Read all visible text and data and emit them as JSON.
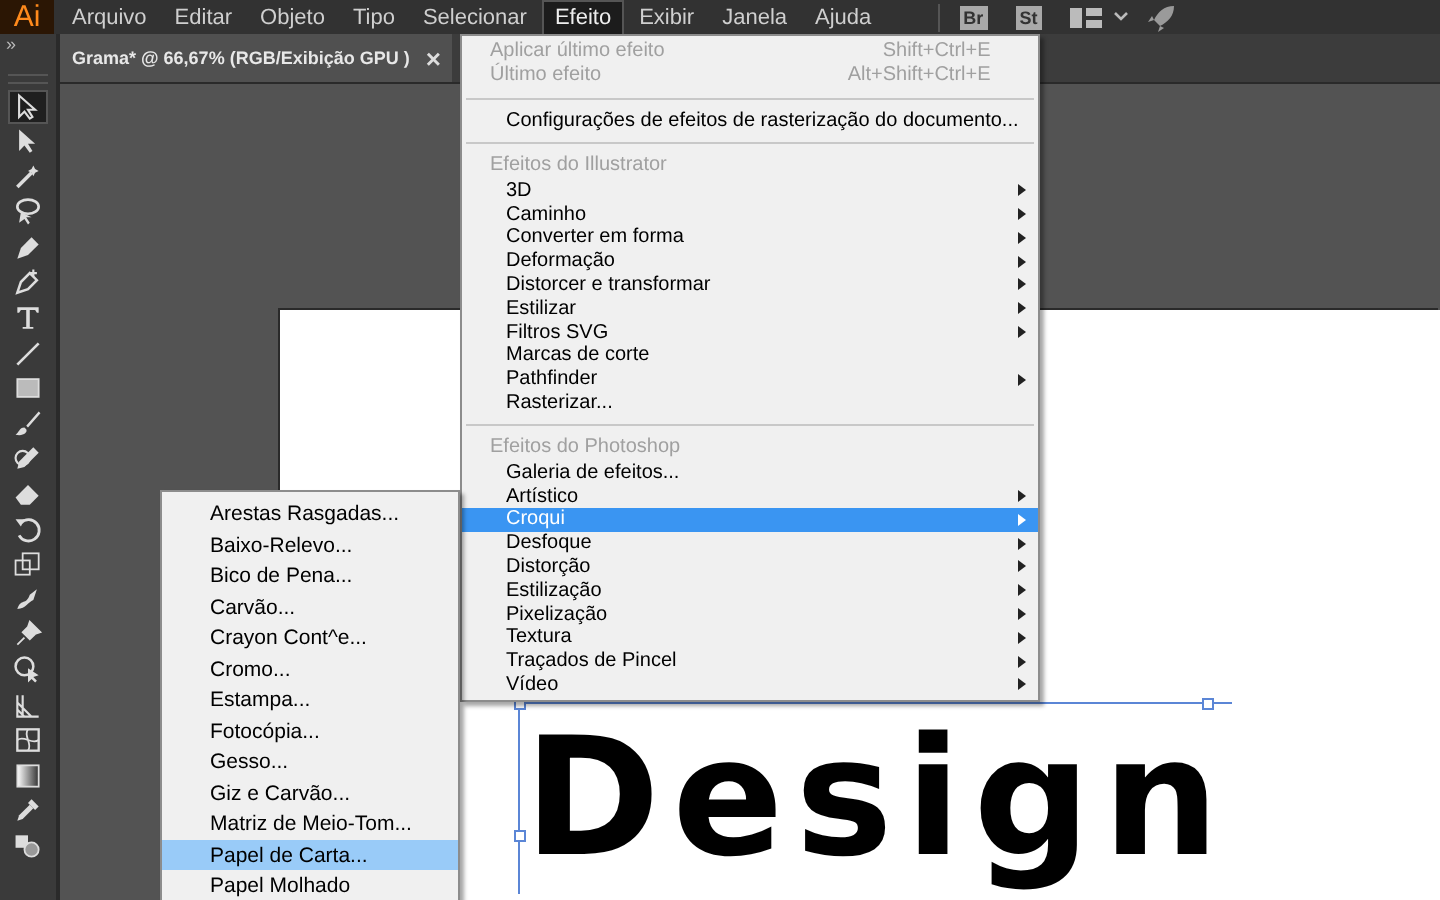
{
  "menubar": {
    "logo": "Ai",
    "items": [
      {
        "label": "Arquivo",
        "selected": false
      },
      {
        "label": "Editar",
        "selected": false
      },
      {
        "label": "Objeto",
        "selected": false
      },
      {
        "label": "Tipo",
        "selected": false
      },
      {
        "label": "Selecionar",
        "selected": false
      },
      {
        "label": "Efeito",
        "selected": true
      },
      {
        "label": "Exibir",
        "selected": false
      },
      {
        "label": "Janela",
        "selected": false
      },
      {
        "label": "Ajuda",
        "selected": false
      }
    ],
    "app_buttons": [
      "Br",
      "St"
    ]
  },
  "document_tab": {
    "title": "Grama* @ 66,67% (RGB/Exibição GPU )",
    "close": "×"
  },
  "toolbar": {
    "collapse": "»",
    "tools": [
      {
        "selected": true
      },
      {
        "selected": false
      },
      {
        "selected": false
      },
      {
        "selected": false
      },
      {
        "selected": false
      },
      {
        "selected": false
      },
      {
        "selected": false
      },
      {
        "selected": false
      },
      {
        "selected": false
      },
      {
        "selected": false
      },
      {
        "selected": false
      },
      {
        "selected": false
      },
      {
        "selected": false
      },
      {
        "selected": false
      },
      {
        "selected": false
      },
      {
        "selected": false
      },
      {
        "selected": false
      },
      {
        "selected": false
      },
      {
        "selected": false
      },
      {
        "selected": false
      },
      {
        "selected": false
      },
      {
        "selected": false
      }
    ]
  },
  "canvas": {
    "text": "Design"
  },
  "effect_menu": {
    "items": [
      {
        "kind": "item",
        "label": "Aplicar último efeito",
        "shortcut": "Shift+Ctrl+E",
        "disabled": true,
        "submenu": false,
        "selected": false
      },
      {
        "kind": "item",
        "label": "Último efeito",
        "shortcut": "Alt+Shift+Ctrl+E",
        "disabled": true,
        "submenu": false,
        "selected": false
      },
      {
        "kind": "separator"
      },
      {
        "kind": "item",
        "label": "Configurações de efeitos de rasterização do documento...",
        "disabled": false,
        "submenu": false,
        "selected": false
      },
      {
        "kind": "separator"
      },
      {
        "kind": "header",
        "label": "Efeitos do Illustrator"
      },
      {
        "kind": "item",
        "label": "3D",
        "disabled": false,
        "submenu": true,
        "selected": false
      },
      {
        "kind": "item",
        "label": "Caminho",
        "disabled": false,
        "submenu": true,
        "selected": false
      },
      {
        "kind": "item",
        "label": "Converter em forma",
        "disabled": false,
        "submenu": true,
        "selected": false
      },
      {
        "kind": "item",
        "label": "Deformação",
        "disabled": false,
        "submenu": true,
        "selected": false
      },
      {
        "kind": "item",
        "label": "Distorcer e transformar",
        "disabled": false,
        "submenu": true,
        "selected": false
      },
      {
        "kind": "item",
        "label": "Estilizar",
        "disabled": false,
        "submenu": true,
        "selected": false
      },
      {
        "kind": "item",
        "label": "Filtros SVG",
        "disabled": false,
        "submenu": true,
        "selected": false
      },
      {
        "kind": "item",
        "label": "Marcas de corte",
        "disabled": false,
        "submenu": false,
        "selected": false
      },
      {
        "kind": "item",
        "label": "Pathfinder",
        "disabled": false,
        "submenu": true,
        "selected": false
      },
      {
        "kind": "item",
        "label": "Rasterizar...",
        "disabled": false,
        "submenu": false,
        "selected": false
      },
      {
        "kind": "separator"
      },
      {
        "kind": "header",
        "label": "Efeitos do Photoshop"
      },
      {
        "kind": "item",
        "label": "Galeria de efeitos...",
        "disabled": false,
        "submenu": false,
        "selected": false
      },
      {
        "kind": "item",
        "label": "Artístico",
        "disabled": false,
        "submenu": true,
        "selected": false
      },
      {
        "kind": "item",
        "label": "Croqui",
        "disabled": false,
        "submenu": true,
        "selected": true
      },
      {
        "kind": "item",
        "label": "Desfoque",
        "disabled": false,
        "submenu": true,
        "selected": false
      },
      {
        "kind": "item",
        "label": "Distorção",
        "disabled": false,
        "submenu": true,
        "selected": false
      },
      {
        "kind": "item",
        "label": "Estilização",
        "disabled": false,
        "submenu": true,
        "selected": false
      },
      {
        "kind": "item",
        "label": "Pixelização",
        "disabled": false,
        "submenu": true,
        "selected": false
      },
      {
        "kind": "item",
        "label": "Textura",
        "disabled": false,
        "submenu": true,
        "selected": false
      },
      {
        "kind": "item",
        "label": "Traçados de Pincel",
        "disabled": false,
        "submenu": true,
        "selected": false
      },
      {
        "kind": "item",
        "label": "Vídeo",
        "disabled": false,
        "submenu": true,
        "selected": false
      }
    ]
  },
  "submenu": {
    "items": [
      {
        "label": "Arestas Rasgadas...",
        "selected": false
      },
      {
        "label": "Baixo-Relevo...",
        "selected": false
      },
      {
        "label": "Bico de Pena...",
        "selected": false
      },
      {
        "label": "Carvão...",
        "selected": false
      },
      {
        "label": "Crayon Cont^e...",
        "selected": false
      },
      {
        "label": "Cromo...",
        "selected": false
      },
      {
        "label": "Estampa...",
        "selected": false
      },
      {
        "label": "Fotocópia...",
        "selected": false
      },
      {
        "label": "Gesso...",
        "selected": false
      },
      {
        "label": "Giz e Carvão...",
        "selected": false
      },
      {
        "label": "Matriz de Meio-Tom...",
        "selected": false
      },
      {
        "label": "Papel de Carta...",
        "selected": true
      },
      {
        "label": "Papel Molhado",
        "selected": false
      }
    ]
  }
}
